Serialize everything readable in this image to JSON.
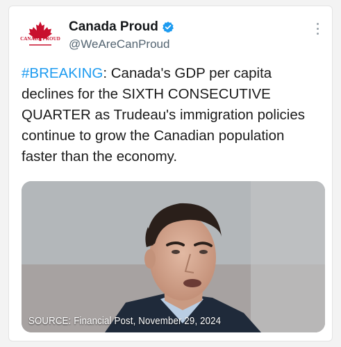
{
  "account": {
    "avatar_text": "CANADA PROUD",
    "display_name": "Canada Proud",
    "handle": "@WeAreCanProud",
    "verified_icon": "verified-badge-icon",
    "more_icon": "more-options-icon"
  },
  "tweet": {
    "hashtag": "#BREAKING",
    "body": ": Canada's GDP per capita declines for the SIXTH CONSECUTIVE QUARTER as Trudeau's immigration policies continue to grow the Canadian population faster than the economy."
  },
  "media": {
    "caption": "SOURCE: Financial Post, November 29, 2024"
  },
  "colors": {
    "hashtag": "#1d9bf0",
    "verified": "#1d9bf0",
    "brand_red": "#c8102e"
  }
}
